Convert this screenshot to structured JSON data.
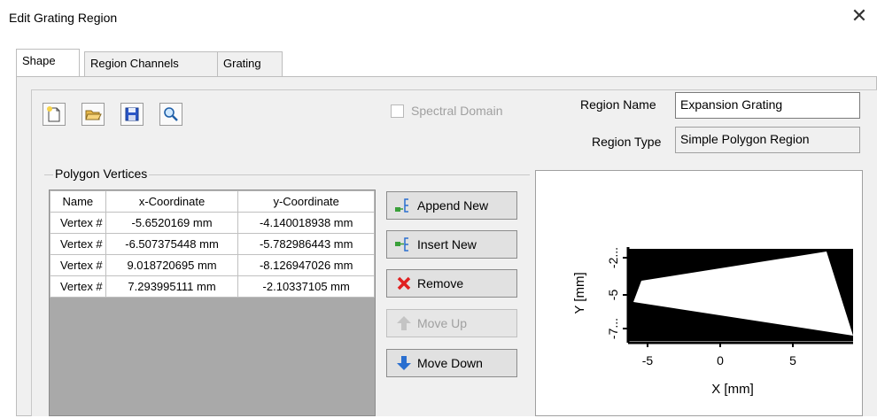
{
  "window": {
    "title": "Edit Grating Region",
    "close_symbol": "✕"
  },
  "tabs": [
    {
      "label": "Shape",
      "active": true
    },
    {
      "label": "Region Channels",
      "active": false
    },
    {
      "label": "Grating",
      "active": false
    }
  ],
  "toolbar": {
    "icons": [
      "new-file-icon",
      "open-folder-icon",
      "save-icon",
      "magnifier-icon"
    ]
  },
  "spectral_domain": {
    "label": "Spectral Domain",
    "checked": false,
    "enabled": false
  },
  "region": {
    "name_label": "Region Name",
    "name_value": "Expansion Grating",
    "type_label": "Region Type",
    "type_value": "Simple Polygon Region"
  },
  "vertices": {
    "group_label": "Polygon Vertices",
    "headers": [
      "Name",
      "x-Coordinate",
      "y-Coordinate"
    ],
    "rows": [
      [
        "Vertex #",
        "-5.6520169 mm",
        "-4.140018938 mm"
      ],
      [
        "Vertex #",
        "-6.507375448 mm",
        "-5.782986443 mm"
      ],
      [
        "Vertex #",
        "9.018720695 mm",
        "-8.126947026 mm"
      ],
      [
        "Vertex #",
        "7.293995111 mm",
        "-2.10337105 mm"
      ]
    ]
  },
  "actions": {
    "append_label": "Append New",
    "insert_label": "Insert New",
    "remove_label": "Remove",
    "move_up_label": "Move Up",
    "move_down_label": "Move Down"
  },
  "preview": {
    "xlabel": "X [mm]",
    "ylabel": "Y [mm]",
    "x_ticks": [
      "-5",
      "0",
      "5"
    ],
    "y_ticks": [
      "-2...",
      "-5",
      "-7..."
    ],
    "colors": {
      "background": "#000000",
      "polygon": "#ffffff"
    }
  }
}
